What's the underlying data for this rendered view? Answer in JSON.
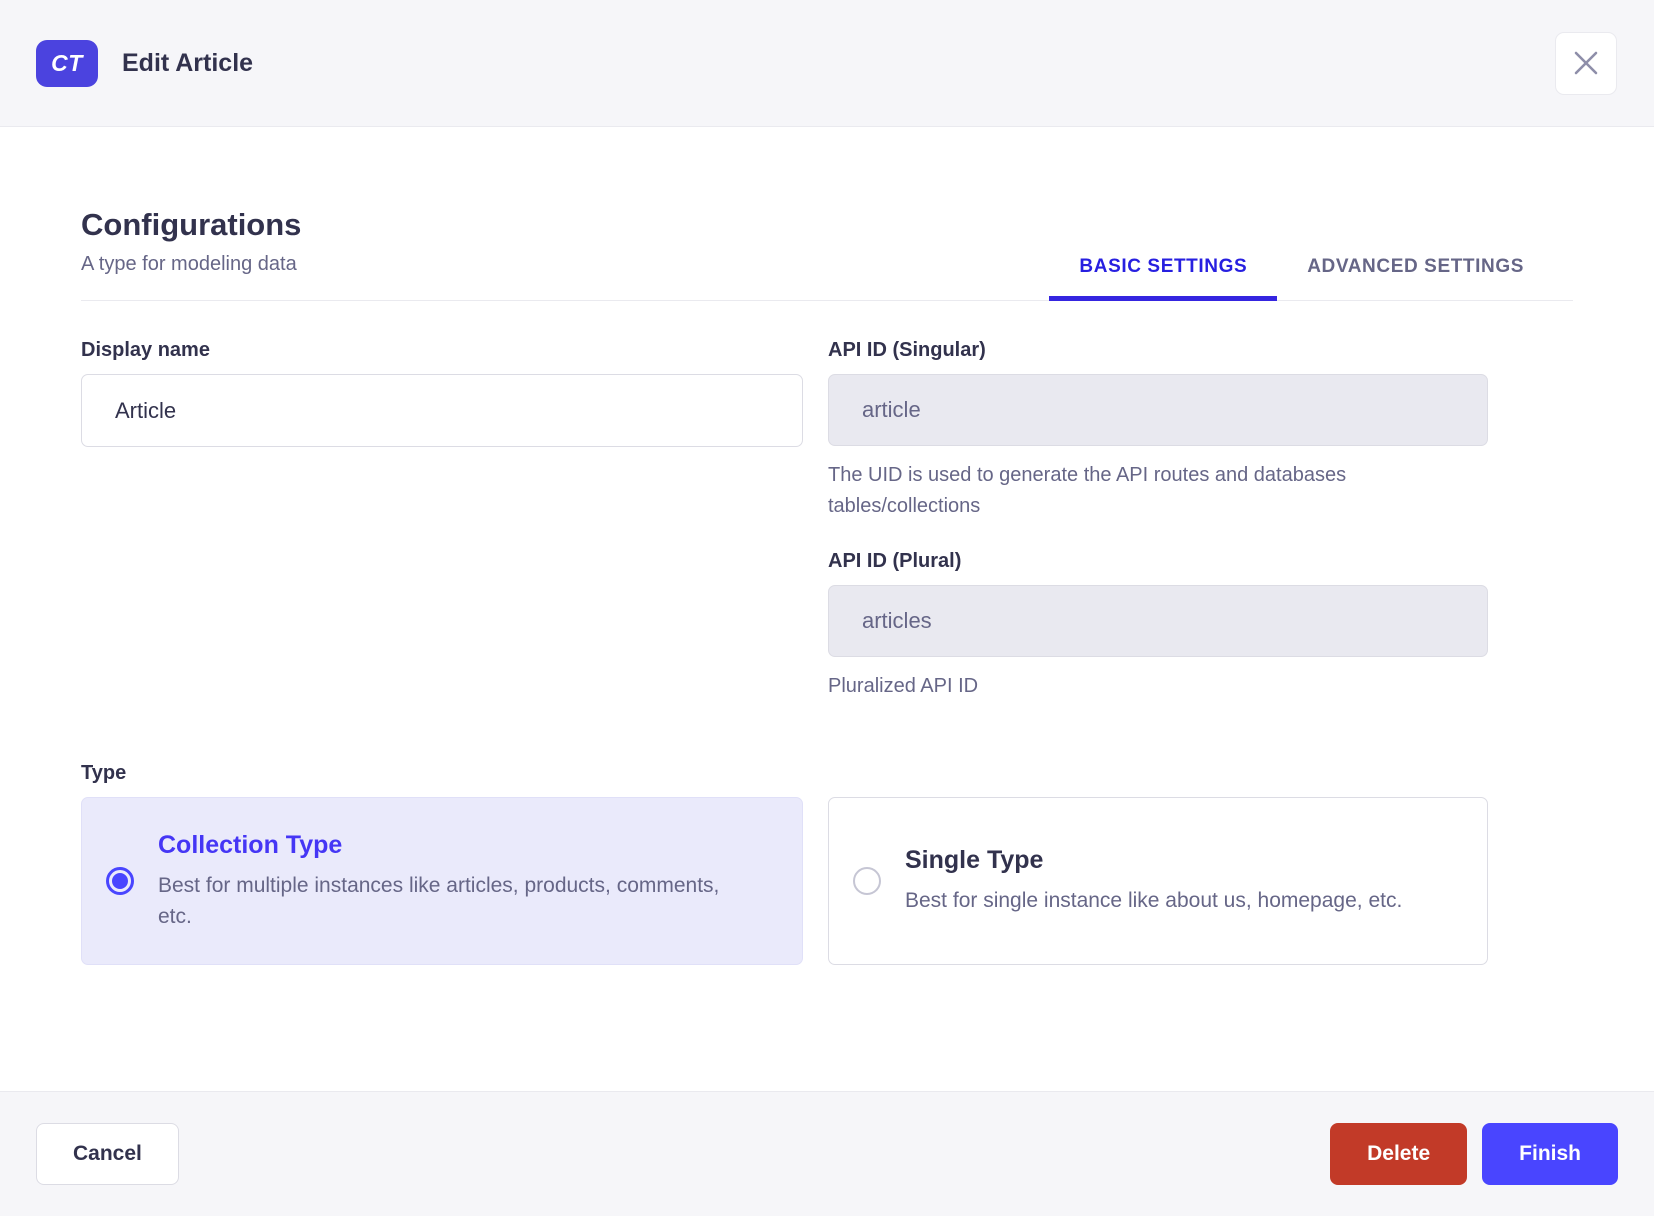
{
  "header": {
    "badge": "CT",
    "title": "Edit Article"
  },
  "section": {
    "title": "Configurations",
    "subtitle": "A type for modeling data"
  },
  "tabs": [
    {
      "label": "BASIC SETTINGS",
      "active": true
    },
    {
      "label": "ADVANCED SETTINGS",
      "active": false
    }
  ],
  "form": {
    "display_name": {
      "label": "Display name",
      "value": "Article"
    },
    "api_id_singular": {
      "label": "API ID (Singular)",
      "value": "article",
      "hint": "The UID is used to generate the API routes and databases tables/collections"
    },
    "api_id_plural": {
      "label": "API ID (Plural)",
      "value": "articles",
      "hint": "Pluralized API ID"
    },
    "type": {
      "label": "Type",
      "options": [
        {
          "title": "Collection Type",
          "description": "Best for multiple instances like articles, products, comments, etc.",
          "selected": true
        },
        {
          "title": "Single Type",
          "description": "Best for single instance like about us, homepage, etc.",
          "selected": false
        }
      ]
    }
  },
  "footer": {
    "cancel": "Cancel",
    "delete": "Delete",
    "finish": "Finish"
  },
  "colors": {
    "primary": "#4945ff",
    "tab_active": "#271fe0",
    "badge_bg": "#4b43df",
    "danger": "#c23a28",
    "selected_card_bg": "#eaeafb",
    "header_bg": "#f6f6f9",
    "text_dark": "#32324d",
    "text_muted": "#666687",
    "border": "#dcdce4"
  }
}
